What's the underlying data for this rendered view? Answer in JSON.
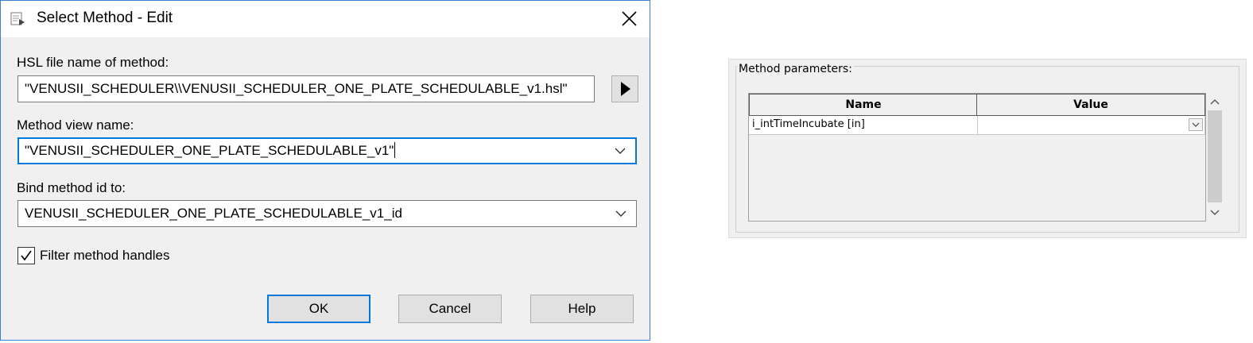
{
  "dialog": {
    "title": "Select Method - Edit",
    "hsl_label": "HSL file name of method:",
    "hsl_value": "\"VENUSII_SCHEDULER\\\\VENUSII_SCHEDULER_ONE_PLATE_SCHEDULABLE_v1.hsl\"",
    "view_label": "Method view name:",
    "view_value": "\"VENUSII_SCHEDULER_ONE_PLATE_SCHEDULABLE_v1\"",
    "bind_label": "Bind method id to:",
    "bind_value": "VENUSII_SCHEDULER_ONE_PLATE_SCHEDULABLE_v1_id",
    "filter_label": "Filter method handles",
    "filter_checked": true,
    "ok_label": "OK",
    "cancel_label": "Cancel",
    "help_label": "Help"
  },
  "params": {
    "group_label": "Method parameters:",
    "columns": [
      "Name",
      "Value"
    ],
    "rows": [
      {
        "name": "i_intTimeIncubate [in]",
        "value": ""
      }
    ]
  },
  "colors": {
    "accent": "#0078d7",
    "dialog_bg": "#f0f0f0",
    "button_bg": "#e1e1e1"
  },
  "icons": {
    "title": "method-file-icon",
    "close": "close-icon",
    "dropdown": "chevron-down-icon",
    "browse": "play-arrow-icon",
    "check": "checkmark-icon"
  }
}
